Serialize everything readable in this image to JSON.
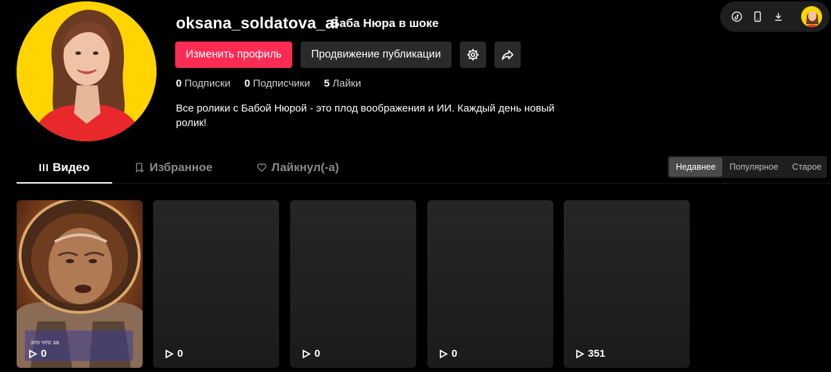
{
  "profile": {
    "username": "oksana_soldatova_ai",
    "nickname": "Баба Нюра в шоке",
    "edit_button": "Изменить профиль",
    "promo_button": "Продвижение публикации",
    "bio": "Все ролики с Бабой Нюрой - это плод воображения и ИИ. Каждый день новый ролик!"
  },
  "stats": [
    {
      "value": "0",
      "label": "Подписки"
    },
    {
      "value": "0",
      "label": "Подписчики"
    },
    {
      "value": "5",
      "label": "Лайки"
    }
  ],
  "toolbar": {
    "icons": [
      "tiktok-icon",
      "phone-icon",
      "download-icon"
    ]
  },
  "tabs": [
    {
      "label": "Видео",
      "icon": "grid-icon",
      "active": true
    },
    {
      "label": "Избранное",
      "icon": "bookmark-icon",
      "active": false
    },
    {
      "label": "Лайкнул(-а)",
      "icon": "heart-icon",
      "active": false
    }
  ],
  "sort": [
    {
      "label": "Недавнее",
      "active": true
    },
    {
      "label": "Популярное",
      "active": false
    },
    {
      "label": "Старое",
      "active": false
    }
  ],
  "videos": [
    {
      "views": "0",
      "caption": "это что за"
    },
    {
      "views": "0"
    },
    {
      "views": "0"
    },
    {
      "views": "0"
    },
    {
      "views": "351"
    }
  ],
  "colors": {
    "accent": "#fe2c55",
    "background": "#000000",
    "button": "#2a2a2a"
  }
}
